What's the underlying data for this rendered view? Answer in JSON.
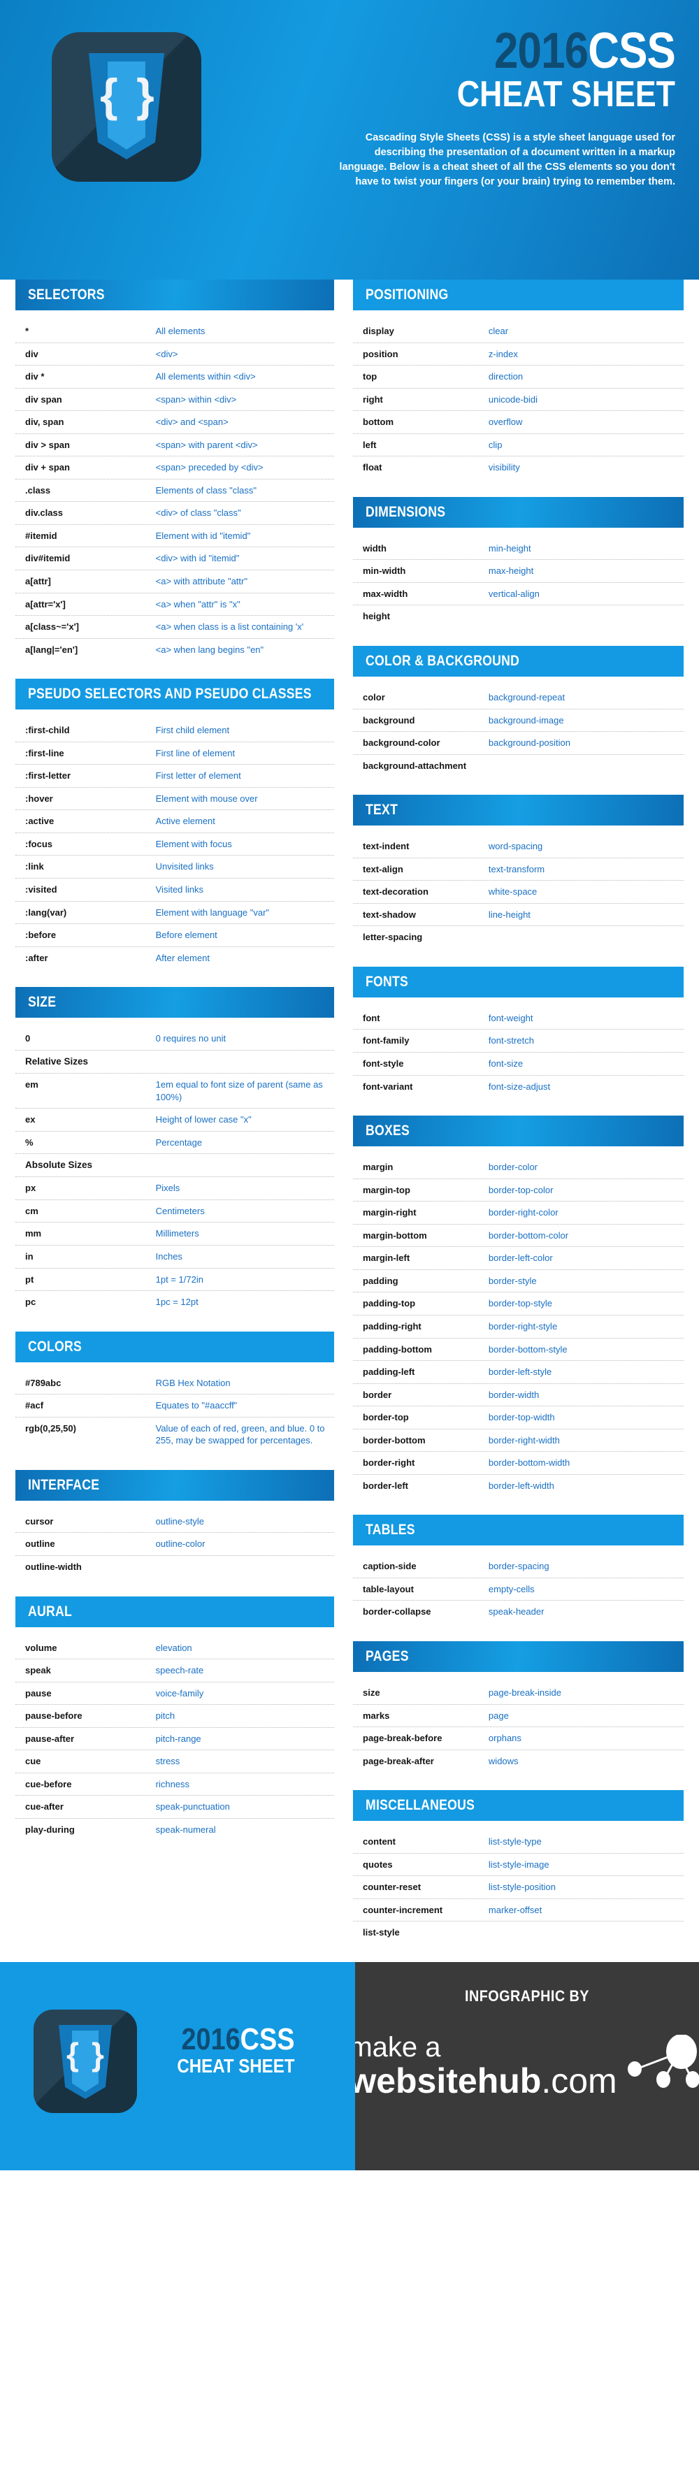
{
  "header": {
    "title_year": "2016",
    "title_css": "CSS",
    "title_line2": "CHEAT SHEET",
    "description": "Cascading Style Sheets (CSS) is a style sheet language used for describing the presentation of a document written in a markup language. Below is a cheat sheet of all the CSS elements so you don't have to twist your fingers (or your brain) trying to remember them.",
    "logo_brace_left": "{",
    "logo_brace_right": "}"
  },
  "colors": {
    "accent_blue": "#139ae2",
    "deep_blue": "#0d6fb6",
    "navy": "#0f4c74",
    "link_blue": "#1970c4",
    "footer_dark": "#3a3a3a",
    "logo_navy": "#1d3b4e"
  },
  "left_column": [
    {
      "id": "selectors",
      "title": "SELECTORS",
      "style": "gradient",
      "rows": [
        {
          "k": "*",
          "v": "All elements"
        },
        {
          "k": "div",
          "v": "<div>"
        },
        {
          "k": "div *",
          "v": "All elements within <div>"
        },
        {
          "k": "div span",
          "v": "<span> within <div>"
        },
        {
          "k": "div, span",
          "v": "<div> and <span>"
        },
        {
          "k": "div > span",
          "v": "<span> with parent <div>"
        },
        {
          "k": "div + span",
          "v": "<span> preceded by <div>"
        },
        {
          "k": ".class",
          "v": "Elements of class \"class\""
        },
        {
          "k": "div.class",
          "v": "<div> of class \"class\""
        },
        {
          "k": "#itemid",
          "v": "Element with id \"itemid\""
        },
        {
          "k": "div#itemid",
          "v": "<div> with id \"itemid\""
        },
        {
          "k": "a[attr]",
          "v": "<a> with attribute \"attr\""
        },
        {
          "k": "a[attr='x']",
          "v": "<a> when \"attr\" is \"x\""
        },
        {
          "k": "a[class~='x']",
          "v": "<a> when class is a list containing 'x'"
        },
        {
          "k": "a[lang|='en']",
          "v": "<a> when lang begins \"en\""
        }
      ]
    },
    {
      "id": "pseudo-selectors",
      "title": "PSEUDO SELECTORS AND PSEUDO CLASSES",
      "style": "flat",
      "rows": [
        {
          "k": ":first-child",
          "v": "First child element"
        },
        {
          "k": ":first-line",
          "v": "First line of element"
        },
        {
          "k": ":first-letter",
          "v": "First letter of element"
        },
        {
          "k": ":hover",
          "v": "Element with mouse over"
        },
        {
          "k": ":active",
          "v": "Active element"
        },
        {
          "k": ":focus",
          "v": "Element with focus"
        },
        {
          "k": ":link",
          "v": "Unvisited links"
        },
        {
          "k": ":visited",
          "v": "Visited links"
        },
        {
          "k": ":lang(var)",
          "v": "Element with language \"var\""
        },
        {
          "k": ":before",
          "v": "Before element"
        },
        {
          "k": ":after",
          "v": "After element"
        }
      ]
    },
    {
      "id": "size",
      "title": "SIZE",
      "style": "gradient",
      "rows": [
        {
          "k": "0",
          "v": "0 requires no unit"
        },
        {
          "k": "Relative Sizes",
          "v": "",
          "subhead": true
        },
        {
          "k": "em",
          "v": "1em equal to font size of parent (same as 100%)"
        },
        {
          "k": "ex",
          "v": "Height of lower case \"x\""
        },
        {
          "k": "%",
          "v": "Percentage"
        },
        {
          "k": "Absolute Sizes",
          "v": "",
          "subhead": true
        },
        {
          "k": "px",
          "v": "Pixels"
        },
        {
          "k": "cm",
          "v": "Centimeters"
        },
        {
          "k": "mm",
          "v": "Millimeters"
        },
        {
          "k": "in",
          "v": "Inches"
        },
        {
          "k": "pt",
          "v": "1pt = 1/72in"
        },
        {
          "k": "pc",
          "v": "1pc = 12pt"
        }
      ]
    },
    {
      "id": "colors",
      "title": "COLORS",
      "style": "flat",
      "rows": [
        {
          "k": "#789abc",
          "v": "RGB Hex Notation"
        },
        {
          "k": "#acf",
          "v": "Equates to \"#aaccff\""
        },
        {
          "k": "rgb(0,25,50)",
          "v": "Value of each of red, green, and blue. 0 to 255, may be swapped for percentages."
        }
      ]
    },
    {
      "id": "interface",
      "title": "INTERFACE",
      "style": "gradient",
      "rows": [
        {
          "k": "cursor",
          "v": "outline-style"
        },
        {
          "k": "outline",
          "v": "outline-color"
        },
        {
          "k": "outline-width",
          "v": ""
        }
      ]
    },
    {
      "id": "aural",
      "title": "AURAL",
      "style": "flat",
      "rows": [
        {
          "k": "volume",
          "v": "elevation"
        },
        {
          "k": "speak",
          "v": "speech-rate"
        },
        {
          "k": "pause",
          "v": "voice-family"
        },
        {
          "k": "pause-before",
          "v": "pitch"
        },
        {
          "k": "pause-after",
          "v": "pitch-range"
        },
        {
          "k": "cue",
          "v": "stress"
        },
        {
          "k": "cue-before",
          "v": "richness"
        },
        {
          "k": "cue-after",
          "v": "speak-punctuation"
        },
        {
          "k": "play-during",
          "v": "speak-numeral"
        }
      ]
    }
  ],
  "right_column": [
    {
      "id": "positioning",
      "title": "POSITIONING",
      "style": "flat",
      "rows": [
        {
          "k": "display",
          "v": "clear"
        },
        {
          "k": "position",
          "v": "z-index"
        },
        {
          "k": "top",
          "v": "direction"
        },
        {
          "k": "right",
          "v": "unicode-bidi"
        },
        {
          "k": "bottom",
          "v": "overflow"
        },
        {
          "k": "left",
          "v": "clip"
        },
        {
          "k": "float",
          "v": "visibility"
        }
      ]
    },
    {
      "id": "dimensions",
      "title": "DIMENSIONS",
      "style": "gradient",
      "rows": [
        {
          "k": "width",
          "v": "min-height"
        },
        {
          "k": "min-width",
          "v": "max-height"
        },
        {
          "k": "max-width",
          "v": "vertical-align"
        },
        {
          "k": "height",
          "v": ""
        }
      ]
    },
    {
      "id": "color-background",
      "title": "COLOR & BACKGROUND",
      "style": "flat",
      "rows": [
        {
          "k": "color",
          "v": "background-repeat"
        },
        {
          "k": "background",
          "v": "background-image"
        },
        {
          "k": "background-color",
          "v": "background-position"
        },
        {
          "k": "background-attachment",
          "v": ""
        }
      ]
    },
    {
      "id": "text",
      "title": "TEXT",
      "style": "gradient",
      "rows": [
        {
          "k": "text-indent",
          "v": "word-spacing"
        },
        {
          "k": "text-align",
          "v": "text-transform"
        },
        {
          "k": "text-decoration",
          "v": "white-space"
        },
        {
          "k": "text-shadow",
          "v": "line-height"
        },
        {
          "k": "letter-spacing",
          "v": ""
        }
      ]
    },
    {
      "id": "fonts",
      "title": "FONTS",
      "style": "flat",
      "rows": [
        {
          "k": "font",
          "v": "font-weight"
        },
        {
          "k": "font-family",
          "v": "font-stretch"
        },
        {
          "k": "font-style",
          "v": "font-size"
        },
        {
          "k": "font-variant",
          "v": "font-size-adjust"
        }
      ]
    },
    {
      "id": "boxes",
      "title": "BOXES",
      "style": "gradient",
      "rows": [
        {
          "k": "margin",
          "v": "border-color"
        },
        {
          "k": "margin-top",
          "v": "border-top-color"
        },
        {
          "k": "margin-right",
          "v": "border-right-color"
        },
        {
          "k": "margin-bottom",
          "v": "border-bottom-color"
        },
        {
          "k": "margin-left",
          "v": "border-left-color"
        },
        {
          "k": "padding",
          "v": "border-style"
        },
        {
          "k": "padding-top",
          "v": "border-top-style"
        },
        {
          "k": "padding-right",
          "v": "border-right-style"
        },
        {
          "k": "padding-bottom",
          "v": "border-bottom-style"
        },
        {
          "k": "padding-left",
          "v": "border-left-style"
        },
        {
          "k": "border",
          "v": "border-width"
        },
        {
          "k": "border-top",
          "v": "border-top-width"
        },
        {
          "k": "border-bottom",
          "v": "border-right-width"
        },
        {
          "k": "border-right",
          "v": "border-bottom-width"
        },
        {
          "k": "border-left",
          "v": "border-left-width"
        }
      ]
    },
    {
      "id": "tables",
      "title": "TABLES",
      "style": "flat",
      "rows": [
        {
          "k": "caption-side",
          "v": "border-spacing"
        },
        {
          "k": "table-layout",
          "v": "empty-cells"
        },
        {
          "k": "border-collapse",
          "v": "speak-header"
        }
      ]
    },
    {
      "id": "pages",
      "title": "PAGES",
      "style": "gradient",
      "rows": [
        {
          "k": "size",
          "v": "page-break-inside"
        },
        {
          "k": "marks",
          "v": "page"
        },
        {
          "k": "page-break-before",
          "v": "orphans"
        },
        {
          "k": "page-break-after",
          "v": "widows"
        }
      ]
    },
    {
      "id": "miscellaneous",
      "title": "MISCELLANEOUS",
      "style": "flat",
      "rows": [
        {
          "k": "content",
          "v": "list-style-type"
        },
        {
          "k": "quotes",
          "v": "list-style-image"
        },
        {
          "k": "counter-reset",
          "v": "list-style-position"
        },
        {
          "k": "counter-increment",
          "v": "marker-offset"
        },
        {
          "k": "list-style",
          "v": ""
        }
      ]
    }
  ],
  "footer": {
    "title_year": "2016",
    "title_css": "CSS",
    "title_line2": "CHEAT SHEET",
    "infographic_by": "INFOGRAPHIC BY",
    "brand_line1": "make a",
    "brand_line2": "websitehub",
    "brand_tld": ".com",
    "logo_brace_left": "{",
    "logo_brace_right": "}"
  }
}
